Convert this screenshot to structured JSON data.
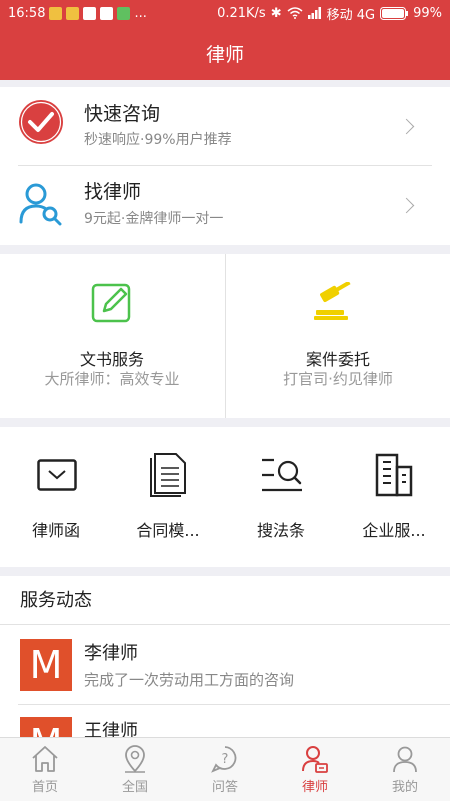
{
  "status": {
    "time": "16:58",
    "network_speed": "0.21K/s",
    "carrier": "移动 4G",
    "battery": "99%",
    "more": "..."
  },
  "header": {
    "title": "律师"
  },
  "quick": [
    {
      "title": "快速咨询",
      "subtitle": "秒速响应·99%用户推荐",
      "icon": "check-circle-icon"
    },
    {
      "title": "找律师",
      "subtitle": "9元起·金牌律师一对一",
      "icon": "person-search-icon"
    }
  ],
  "services": [
    {
      "name": "文书服务",
      "desc": "大所律师：高效专业",
      "icon": "pencil-edit-icon",
      "color": "#4cc24c"
    },
    {
      "name": "案件委托",
      "desc": "打官司·约见律师",
      "icon": "gavel-icon",
      "color": "#f0d000"
    }
  ],
  "tools": [
    {
      "label": "律师函",
      "icon": "envelope-icon"
    },
    {
      "label": "合同模...",
      "icon": "document-icon"
    },
    {
      "label": "搜法条",
      "icon": "search-list-icon"
    },
    {
      "label": "企业服...",
      "icon": "building-icon"
    }
  ],
  "feed": {
    "title": "服务动态",
    "items": [
      {
        "avatar": "M",
        "name": "李律师",
        "desc": "完成了一次劳动用工方面的咨询"
      },
      {
        "avatar": "M",
        "name": "王律师",
        "desc": ""
      }
    ]
  },
  "nav": [
    {
      "label": "首页",
      "icon": "home-icon",
      "active": false
    },
    {
      "label": "全国",
      "icon": "location-pin-icon",
      "active": false
    },
    {
      "label": "问答",
      "icon": "question-icon",
      "active": false
    },
    {
      "label": "律师",
      "icon": "lawyer-icon",
      "active": true
    },
    {
      "label": "我的",
      "icon": "profile-icon",
      "active": false
    }
  ],
  "colors": {
    "brand": "#d94040",
    "avatar": "#e0502b"
  }
}
